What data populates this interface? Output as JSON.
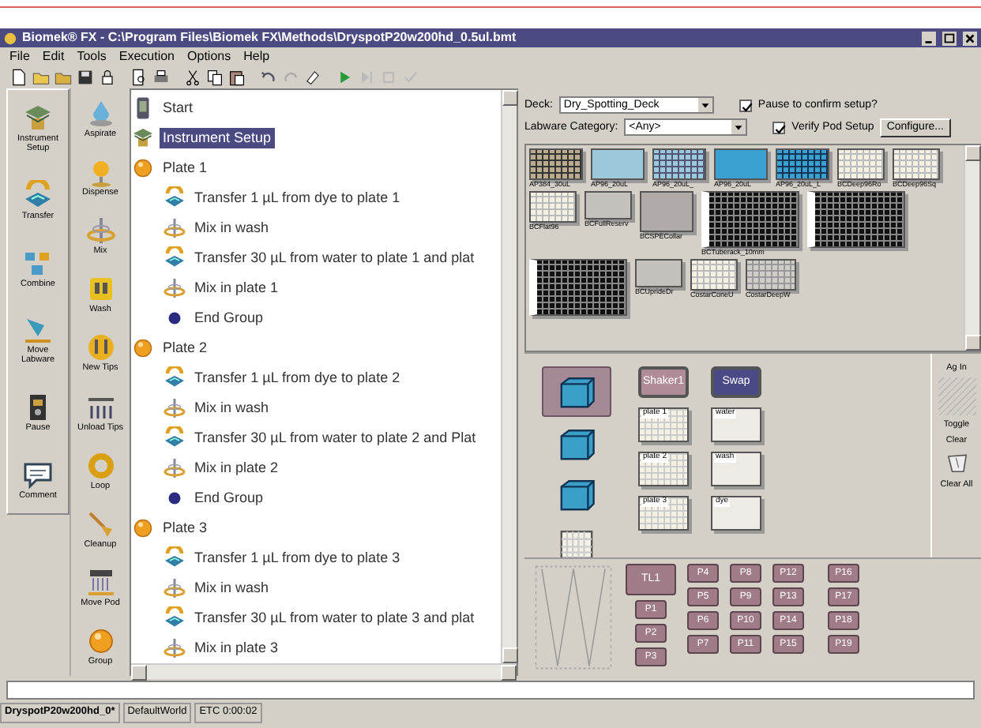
{
  "window": {
    "title": "Biomek® FX - C:\\Program Files\\Biomek FX\\Methods\\DryspotP20w200hd_0.5ul.bmt"
  },
  "menu": [
    "File",
    "Edit",
    "Tools",
    "Execution",
    "Options",
    "Help"
  ],
  "palette": {
    "column_1": [
      {
        "kind": "setup",
        "label": "Instrument Setup"
      },
      {
        "kind": "transfer",
        "label": "Transfer"
      },
      {
        "kind": "combine",
        "label": "Combine"
      },
      {
        "kind": "move",
        "label": "Move Labware"
      },
      {
        "kind": "pause",
        "label": "Pause"
      },
      {
        "kind": "comment",
        "label": "Comment"
      }
    ],
    "column_2": [
      {
        "kind": "aspirate",
        "label": "Aspirate"
      },
      {
        "kind": "dispense",
        "label": "Dispense"
      },
      {
        "kind": "mix",
        "label": "Mix"
      },
      {
        "kind": "wash",
        "label": "Wash"
      },
      {
        "kind": "newtips",
        "label": "New Tips"
      },
      {
        "kind": "unload",
        "label": "Unload Tips"
      },
      {
        "kind": "loop",
        "label": "Loop"
      },
      {
        "kind": "cleanup",
        "label": "Cleanup"
      },
      {
        "kind": "movepod",
        "label": "Move Pod"
      },
      {
        "kind": "group",
        "label": "Group"
      }
    ]
  },
  "method_tree": [
    {
      "kind": "start",
      "label": "Start",
      "selected": false
    },
    {
      "kind": "setup",
      "label": "Instrument Setup",
      "selected": true
    },
    {
      "kind": "group",
      "label": "Plate 1",
      "selected": false,
      "children": [
        {
          "kind": "transfer",
          "label": "Transfer 1 µL from dye to plate 1",
          "selected": false
        },
        {
          "kind": "mix",
          "label": "Mix in wash",
          "selected": false
        },
        {
          "kind": "transfer",
          "label": "Transfer 30 µL from water to plate 1 and plat",
          "selected": false
        },
        {
          "kind": "mix",
          "label": "Mix in plate 1",
          "selected": false
        },
        {
          "kind": "end",
          "label": "End Group",
          "selected": false
        }
      ]
    },
    {
      "kind": "group",
      "label": "Plate  2",
      "selected": false,
      "children": [
        {
          "kind": "transfer",
          "label": "Transfer 1 µL from dye to plate 2",
          "selected": false
        },
        {
          "kind": "mix",
          "label": "Mix in wash",
          "selected": false
        },
        {
          "kind": "transfer",
          "label": "Transfer 30 µL from water to plate 2 and Plat",
          "selected": false
        },
        {
          "kind": "mix",
          "label": "Mix in plate 2",
          "selected": false
        },
        {
          "kind": "end",
          "label": "End Group",
          "selected": false
        }
      ]
    },
    {
      "kind": "group",
      "label": "Plate 3",
      "selected": false,
      "children": [
        {
          "kind": "transfer",
          "label": "Transfer 1 µL from dye to plate 3",
          "selected": false
        },
        {
          "kind": "mix",
          "label": "Mix in wash",
          "selected": false
        },
        {
          "kind": "transfer",
          "label": "Transfer 30 µL from water to plate 3 and plat",
          "selected": false
        },
        {
          "kind": "mix",
          "label": "Mix in plate 3",
          "selected": false
        }
      ]
    }
  ],
  "deck_setup": {
    "deck_label": "Deck:",
    "deck": "Dry_Spotting_Deck",
    "category_label": "Labware Category:",
    "labware_category": "<Any>",
    "options": [
      {
        "label": "Pause to confirm setup?",
        "checked": true
      },
      {
        "label": "Verify Pod Setup",
        "checked": true
      }
    ],
    "configure_button": "Configure..."
  },
  "labware_gallery": [
    {
      "kind": "tan",
      "label": "AP384_30uL"
    },
    {
      "kind": "lightblue",
      "label": "AP96_20uL"
    },
    {
      "kind": "lightblue-grid",
      "label": "AP96_20uL_"
    },
    {
      "kind": "blue",
      "label": "AP96_20uL"
    },
    {
      "kind": "blue-grid",
      "label": "AP96_20uL_L"
    },
    {
      "kind": "white-grid",
      "label": "BCDeep96Ro"
    },
    {
      "kind": "white-grid",
      "label": "BCDeep96Sq"
    },
    {
      "kind": "white-grid",
      "label": "BCFlat96"
    },
    {
      "kind": "grey-frame",
      "label": "BCFullReserv"
    },
    {
      "kind": "grey-box",
      "label": "BCSPECollar"
    },
    {
      "kind": "black-rack",
      "label": "BCTuberack_10mm"
    },
    {
      "kind": "black-rack"
    },
    {
      "kind": "black-rack"
    },
    {
      "kind": "grey-frame",
      "label": "BCUprideDr"
    },
    {
      "kind": "white-grid",
      "label": "CostarConeU"
    },
    {
      "kind": "grey-grid",
      "label": "CostarDeepW"
    }
  ],
  "deck": {
    "stack": [
      {
        "kind": "tipbox",
        "selected": true
      },
      {
        "kind": "tipbox",
        "selected": false
      },
      {
        "kind": "tipbox",
        "selected": false
      },
      {
        "kind": "plate",
        "selected": false
      }
    ],
    "columns": [
      [
        {
          "kind": "button",
          "label": "Shaker1",
          "selected": false
        },
        {
          "kind": "plate",
          "label": "plate 1"
        },
        {
          "kind": "plate",
          "label": "plate 2"
        },
        {
          "kind": "plate",
          "label": "plate 3"
        }
      ],
      [
        {
          "kind": "button",
          "label": "Swap",
          "selected": true
        },
        {
          "kind": "reservoir",
          "label": "water"
        },
        {
          "kind": "reservoir",
          "label": "wash"
        },
        {
          "kind": "reservoir",
          "label": "dye"
        }
      ]
    ],
    "side_panel": [
      "Ag In",
      "Toggle",
      "Clear",
      "Clear All"
    ]
  },
  "pods": [
    [
      {
        "kind": "tool",
        "label": "TL1"
      },
      {
        "kind": "pod",
        "label": "P1"
      },
      {
        "kind": "pod",
        "label": "P2"
      },
      {
        "kind": "pod",
        "label": "P3"
      }
    ],
    [
      {
        "kind": "pod",
        "label": "P4"
      },
      {
        "kind": "pod",
        "label": "P5"
      },
      {
        "kind": "pod",
        "label": "P6"
      },
      {
        "kind": "pod",
        "label": "P7"
      }
    ],
    [
      {
        "kind": "pod",
        "label": "P8"
      },
      {
        "kind": "pod",
        "label": "P9"
      },
      {
        "kind": "pod",
        "label": "P10"
      },
      {
        "kind": "pod",
        "label": "P11"
      }
    ],
    [
      {
        "kind": "pod",
        "label": "P12"
      },
      {
        "kind": "pod",
        "label": "P13"
      },
      {
        "kind": "pod",
        "label": "P14"
      },
      {
        "kind": "pod",
        "label": "P15"
      }
    ],
    [
      {
        "kind": "pod",
        "label": "P16"
      },
      {
        "kind": "pod",
        "label": "P17"
      },
      {
        "kind": "pod",
        "label": "P18"
      },
      {
        "kind": "pod",
        "label": "P19"
      }
    ]
  ],
  "status_bar": [
    "DryspotP20w200hd_0*",
    "DefaultWorld",
    "ETC 0:00:02"
  ]
}
